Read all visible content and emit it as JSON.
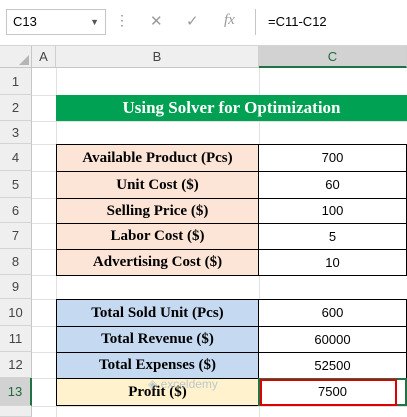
{
  "formula_bar": {
    "name_box": "C13",
    "formula": "=C11-C12",
    "cancel_glyph": "✕",
    "enter_glyph": "✓",
    "fx_glyph": "fx"
  },
  "columns": [
    "A",
    "B",
    "C"
  ],
  "rows": [
    "1",
    "2",
    "3",
    "4",
    "5",
    "6",
    "7",
    "8",
    "9",
    "10",
    "11",
    "12",
    "13"
  ],
  "title": "Using Solver for Optimization",
  "inputs": [
    {
      "label": "Available Product (Pcs)",
      "value": "700"
    },
    {
      "label": "Unit Cost ($)",
      "value": "60"
    },
    {
      "label": "Selling Price ($)",
      "value": "100"
    },
    {
      "label": "Labor Cost ($)",
      "value": "5"
    },
    {
      "label": "Advertising Cost ($)",
      "value": "10"
    }
  ],
  "results": [
    {
      "label": "Total Sold Unit (Pcs)",
      "value": "600"
    },
    {
      "label": "Total Revenue ($)",
      "value": "60000"
    },
    {
      "label": "Total Expenses ($)",
      "value": "52500"
    },
    {
      "label": "Profit ($)",
      "value": "7500"
    }
  ],
  "watermark": "exceldemy",
  "colors": {
    "title_bg": "#00a152",
    "input_label_bg": "#fce4d6",
    "result_label_bg": "#c5d9f1",
    "profit_label_bg": "#fff2cc",
    "highlight": "#e00000"
  }
}
